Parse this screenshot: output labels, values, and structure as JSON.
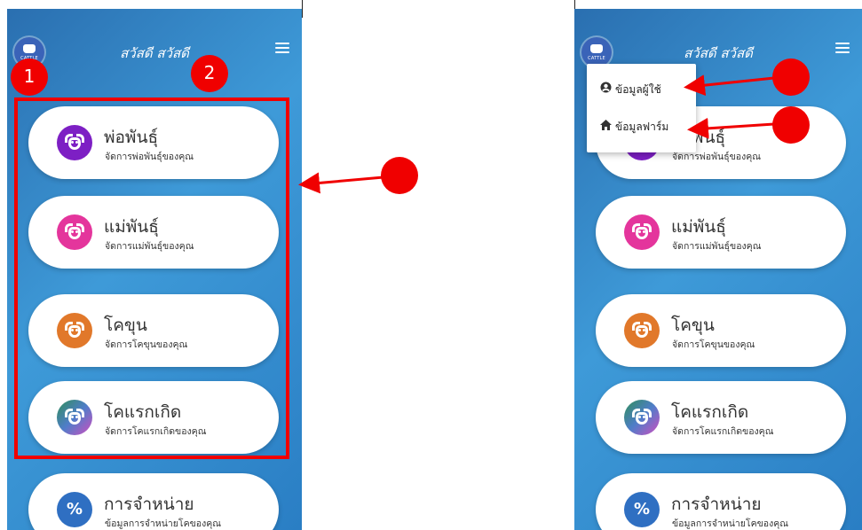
{
  "app": {
    "greeting": "สวัสดี สวัสดี",
    "logo_text": "CATTLE"
  },
  "menu_cards": [
    {
      "title": "พ่อพันธุ์",
      "subtitle": "จัดการพ่อพันธุ์ของคุณ",
      "icon": "cow-icon",
      "color": "#7d1fc4"
    },
    {
      "title": "แม่พันธุ์",
      "subtitle": "จัดการแม่พันธุ์ของคุณ",
      "icon": "cow-icon",
      "color": "#e4359c"
    },
    {
      "title": "โคขุน",
      "subtitle": "จัดการโคขุนของคุณ",
      "icon": "cow-icon",
      "color": "#e1782a"
    },
    {
      "title": "โคแรกเกิด",
      "subtitle": "จัดการโคแรกเกิดของคุณ",
      "icon": "cow-icon",
      "color": "gradient"
    },
    {
      "title": "การจำหน่าย",
      "subtitle": "ข้อมูลการจำหน่ายโคของคุณ",
      "icon": "percent-badge-icon",
      "color": "#2f6fc2"
    }
  ],
  "dropdown": {
    "items": [
      {
        "label": "ข้อมูลผู้ใช้",
        "icon": "user-circle-icon"
      },
      {
        "label": "ข้อมูลฟาร์ม",
        "icon": "home-icon"
      }
    ]
  },
  "annotations": {
    "tag_1": "1",
    "tag_2": "2",
    "accent": "#f00000"
  }
}
